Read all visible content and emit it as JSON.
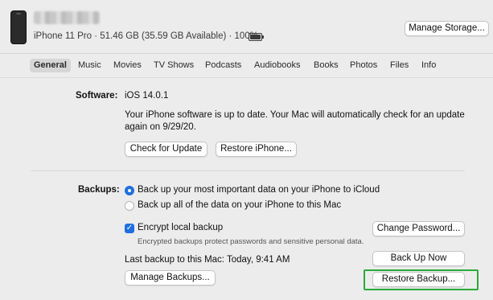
{
  "device": {
    "info": "iPhone 11 Pro · 51.46 GB (35.59 GB Available) · 100%",
    "manage_storage_label": "Manage Storage..."
  },
  "tabs": [
    {
      "label": "General",
      "active": true
    },
    {
      "label": "Music"
    },
    {
      "label": "Movies"
    },
    {
      "label": "TV Shows"
    },
    {
      "label": "Podcasts"
    },
    {
      "label": "Audiobooks"
    },
    {
      "label": "Books"
    },
    {
      "label": "Photos"
    },
    {
      "label": "Files"
    },
    {
      "label": "Info"
    }
  ],
  "software": {
    "label": "Software:",
    "version": "iOS 14.0.1",
    "status_line1": "Your iPhone software is up to date. Your Mac will automatically check for an update",
    "status_line2": "again on 9/29/20.",
    "check_update_label": "Check for Update",
    "restore_iphone_label": "Restore iPhone..."
  },
  "backups": {
    "label": "Backups:",
    "option_icloud": "Back up your most important data on your iPhone to iCloud",
    "option_mac": "Back up all of the data on your iPhone to this Mac",
    "selected_option": "icloud",
    "encrypt_label": "Encrypt local backup",
    "encrypt_checked": true,
    "encrypt_note": "Encrypted backups protect passwords and sensitive personal data.",
    "change_password_label": "Change Password...",
    "last_backup": "Last backup to this Mac:  Today, 9:41 AM",
    "back_up_now_label": "Back Up Now",
    "manage_backups_label": "Manage Backups...",
    "restore_backup_label": "Restore Backup..."
  },
  "colors": {
    "accent": "#1f6fe0",
    "highlight": "#2aaa3a"
  }
}
